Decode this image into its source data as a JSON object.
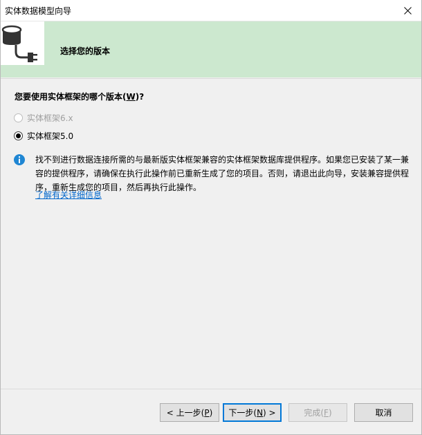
{
  "window": {
    "title": "实体数据模型向导",
    "close_glyph": "✕"
  },
  "header": {
    "title": "选择您的版本",
    "icon": "database-plug-icon"
  },
  "question": {
    "prefix": "您要使用实体框架的哪个版本(",
    "mnemonic": "W",
    "suffix": ")?"
  },
  "options": [
    {
      "label": "实体框架6.x",
      "selected": false,
      "enabled": false
    },
    {
      "label": "实体框架5.0",
      "selected": true,
      "enabled": true
    }
  ],
  "info": {
    "icon": "info-icon",
    "message": "找不到进行数据连接所需的与最新版实体框架兼容的实体框架数据库提供程序。如果您已安装了某一兼容的提供程序，请确保在执行此操作前已重新生成了您的项目。否则，请退出此向导，安装兼容提供程序，重新生成您的项目，然后再执行此操作。",
    "link": "了解有关详细信息"
  },
  "buttons": {
    "back": {
      "prefix": "< 上一步(",
      "mnemonic": "P",
      "suffix": ")"
    },
    "next": {
      "prefix": "下一步(",
      "mnemonic": "N",
      "suffix": ") >"
    },
    "finish": {
      "prefix": "完成(",
      "mnemonic": "F",
      "suffix": ")"
    },
    "cancel": {
      "label": "取消"
    }
  },
  "colors": {
    "header_bg": "#cce8cf",
    "link": "#0066cc",
    "info_icon": "#1f86d3",
    "primary_border": "#0078d7"
  }
}
